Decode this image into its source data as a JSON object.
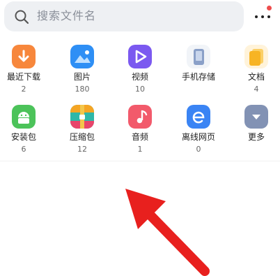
{
  "search": {
    "placeholder": "搜索文件名"
  },
  "categories": [
    {
      "label": "最近下载",
      "count": "2",
      "icon": "download-icon",
      "color": "#f7873c"
    },
    {
      "label": "图片",
      "count": "180",
      "icon": "image-icon",
      "color": "#2e8ff5"
    },
    {
      "label": "视频",
      "count": "10",
      "icon": "play-icon",
      "color": "#7b59f0"
    },
    {
      "label": "手机存储",
      "count": "",
      "icon": "phone-storage-icon",
      "color": "#8aa0c8"
    },
    {
      "label": "文档",
      "count": "4",
      "icon": "document-icon",
      "color": "#f7b424"
    },
    {
      "label": "安装包",
      "count": "6",
      "icon": "android-icon",
      "color": "#4cc35a"
    },
    {
      "label": "压缩包",
      "count": "12",
      "icon": "zip-icon",
      "color": "#2fb7a8"
    },
    {
      "label": "音频",
      "count": "1",
      "icon": "music-note-icon",
      "color": "#f25a6b"
    },
    {
      "label": "离线网页",
      "count": "0",
      "icon": "browser-e-icon",
      "color": "#3a84f4"
    },
    {
      "label": "更多",
      "count": "",
      "icon": "chevron-down-icon",
      "color": "#8292b4"
    }
  ],
  "annotation": {
    "arrow_color": "#e8201e"
  }
}
